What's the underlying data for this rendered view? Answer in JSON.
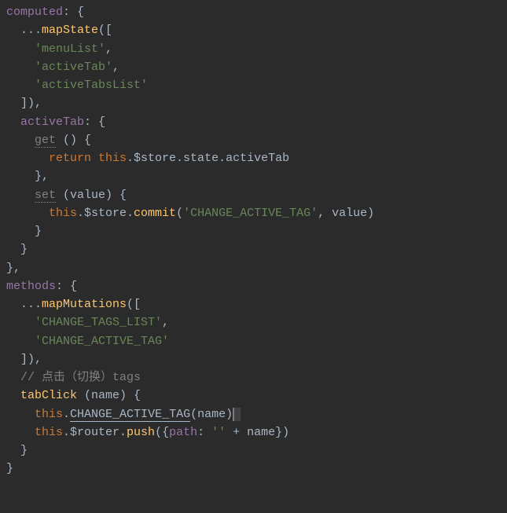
{
  "code": {
    "l1": {
      "a": "computed",
      "b": ": {"
    },
    "l2": {
      "a": "  ...",
      "b": "mapState",
      "c": "(["
    },
    "l3": {
      "a": "    ",
      "b": "'menuList'",
      "c": ","
    },
    "l4": {
      "a": "    ",
      "b": "'activeTab'",
      "c": ","
    },
    "l5": {
      "a": "    ",
      "b": "'activeTabsList'"
    },
    "l6": {
      "a": "  ]),"
    },
    "l7": {
      "a": "  ",
      "b": "activeTab",
      "c": ": {"
    },
    "l8": {
      "a": "    ",
      "b": "get",
      "c": " () {"
    },
    "l9": {
      "a": "      ",
      "b": "return ",
      "c": "this",
      "d": ".$store.state.activeTab"
    },
    "l10": {
      "a": "    },"
    },
    "l11": {
      "a": "    ",
      "b": "set",
      "c": " (value) {"
    },
    "l12": {
      "a": "      ",
      "b": "this",
      "c": ".$store.",
      "d": "commit",
      "e": "(",
      "f": "'CHANGE_ACTIVE_TAG'",
      "g": ", value)"
    },
    "l13": {
      "a": "    }"
    },
    "l14": {
      "a": "  }"
    },
    "l15": {
      "a": "},"
    },
    "l16": {
      "a": "methods",
      "b": ": {"
    },
    "l17": {
      "a": "  ...",
      "b": "mapMutations",
      "c": "(["
    },
    "l18": {
      "a": "    ",
      "b": "'CHANGE_TAGS_LIST'",
      "c": ","
    },
    "l19": {
      "a": "    ",
      "b": "'CHANGE_ACTIVE_TAG'"
    },
    "l20": {
      "a": "  ]),"
    },
    "l21": {
      "a": "  ",
      "b": "// 点击（切换）tags"
    },
    "l22": {
      "a": "  ",
      "b": "tabClick",
      "c": " (name) {"
    },
    "l23": {
      "a": "    ",
      "b": "this",
      "c": ".",
      "d": "CHANGE_ACTIVE_TAG",
      "e": "(name)"
    },
    "l24": {
      "a": "    ",
      "b": "this",
      "c": ".$router.",
      "d": "push",
      "e": "({",
      "f": "path",
      "g": ": ",
      "h": "''",
      "i": " + name})"
    },
    "l25": {
      "a": "  }"
    },
    "l26": {
      "a": "}"
    }
  }
}
